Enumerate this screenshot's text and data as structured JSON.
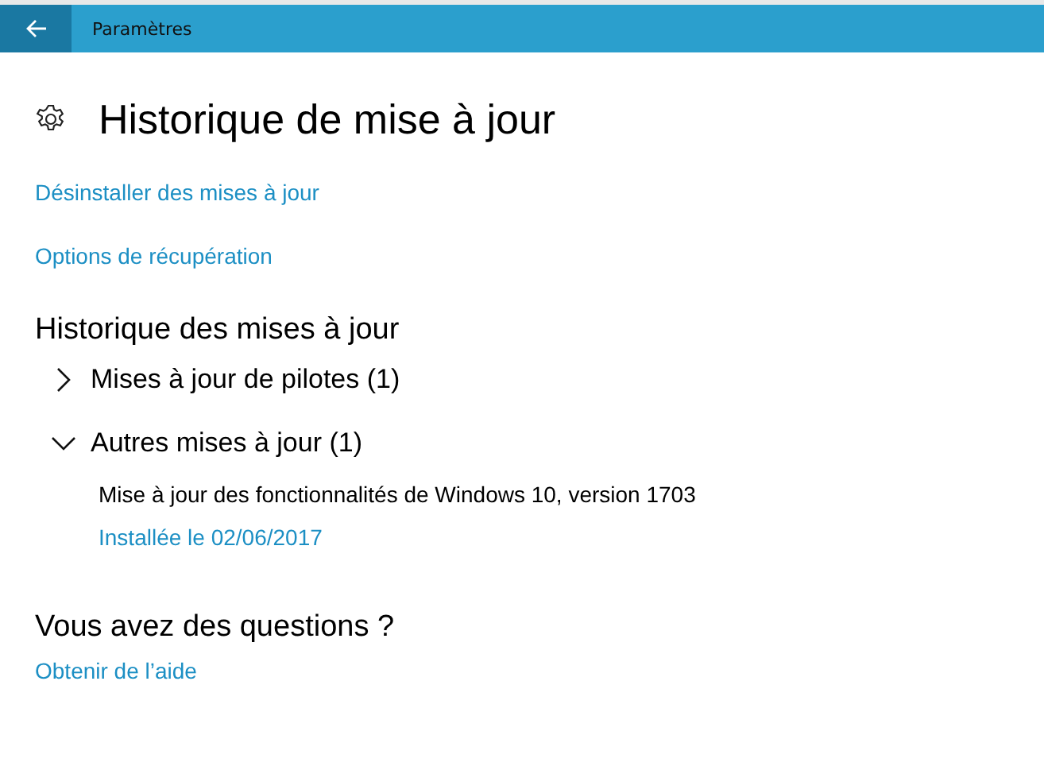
{
  "window": {
    "title": "Paramètres"
  },
  "page": {
    "title": "Historique de mise à jour"
  },
  "links": [
    "Désinstaller des mises à jour",
    "Options de récupération"
  ],
  "history": {
    "heading": "Historique des mises à jour",
    "groups": [
      {
        "label": "Mises à jour de pilotes (1)",
        "expanded": false
      },
      {
        "label": "Autres mises à jour (1)",
        "expanded": true,
        "children": [
          {
            "name": "Mise à jour des fonctionnalités de Windows 10, version 1703",
            "installed": "Installée le 02/06/2017"
          }
        ]
      }
    ]
  },
  "help": {
    "heading": "Vous avez des questions ?",
    "link": "Obtenir de l’aide"
  }
}
